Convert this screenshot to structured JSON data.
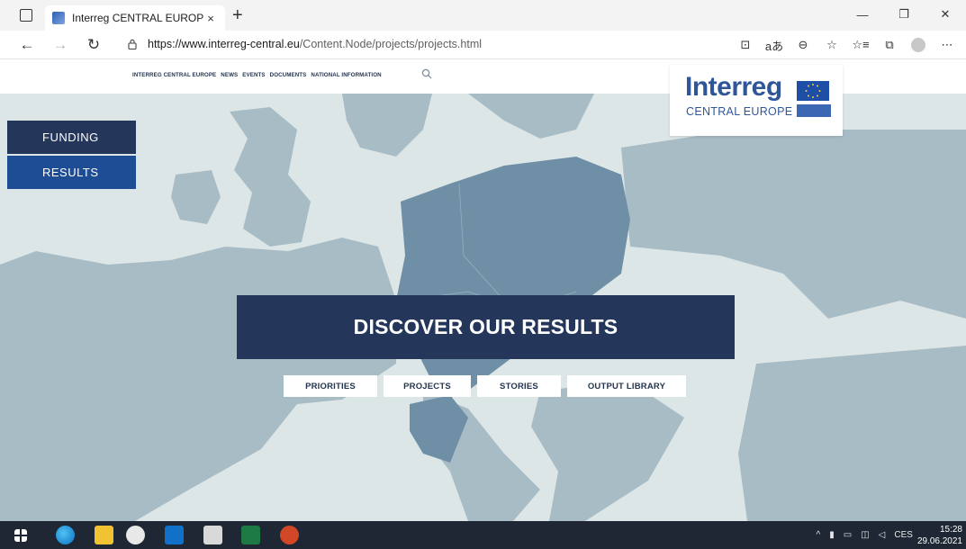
{
  "browser": {
    "tab_title": "Interreg CENTRAL EUROPE - Pro",
    "tab_close": "×",
    "new_tab": "+",
    "window_minimize": "—",
    "window_restore": "❐",
    "window_close": "✕",
    "nav_back": "←",
    "nav_forward": "→",
    "nav_reload": "↻",
    "url_host": "https://www.interreg-central.eu",
    "url_path": "/Content.Node/projects/projects.html",
    "addr_icons": [
      "⊡",
      "aあ",
      "⊖",
      "☆",
      "☆≡",
      "⧉",
      "⋯"
    ]
  },
  "site": {
    "topnav": [
      "INTERREG CENTRAL EUROPE",
      "NEWS",
      "EVENTS",
      "DOCUMENTS",
      "NATIONAL INFORMATION"
    ],
    "logo": {
      "word": "Interreg",
      "sub": "CENTRAL EUROPE"
    },
    "side_menu": {
      "funding": "FUNDING",
      "results": "RESULTS"
    },
    "hero_title": "DISCOVER OUR RESULTS",
    "pills": {
      "priorities": "PRIORITIES",
      "projects": "PROJECTS",
      "stories": "STORIES",
      "output_library": "OUTPUT LIBRARY"
    }
  },
  "taskbar": {
    "icons": [
      "windows-start-icon",
      "edge-icon",
      "file-explorer-icon",
      "photos-icon",
      "outlook-icon",
      "calculator-icon",
      "excel-icon",
      "powerpoint-icon"
    ],
    "tray": {
      "chevron": "^",
      "lang": "CES",
      "time": "15:28",
      "date": "29.06.2021"
    }
  },
  "colors": {
    "navy": "#24365a",
    "blue": "#1e4d96",
    "map_bg": "#dde6e7",
    "land": "#a8bcc6",
    "land_highlight": "#6f8fa6",
    "taskbar": "#1e2733"
  }
}
